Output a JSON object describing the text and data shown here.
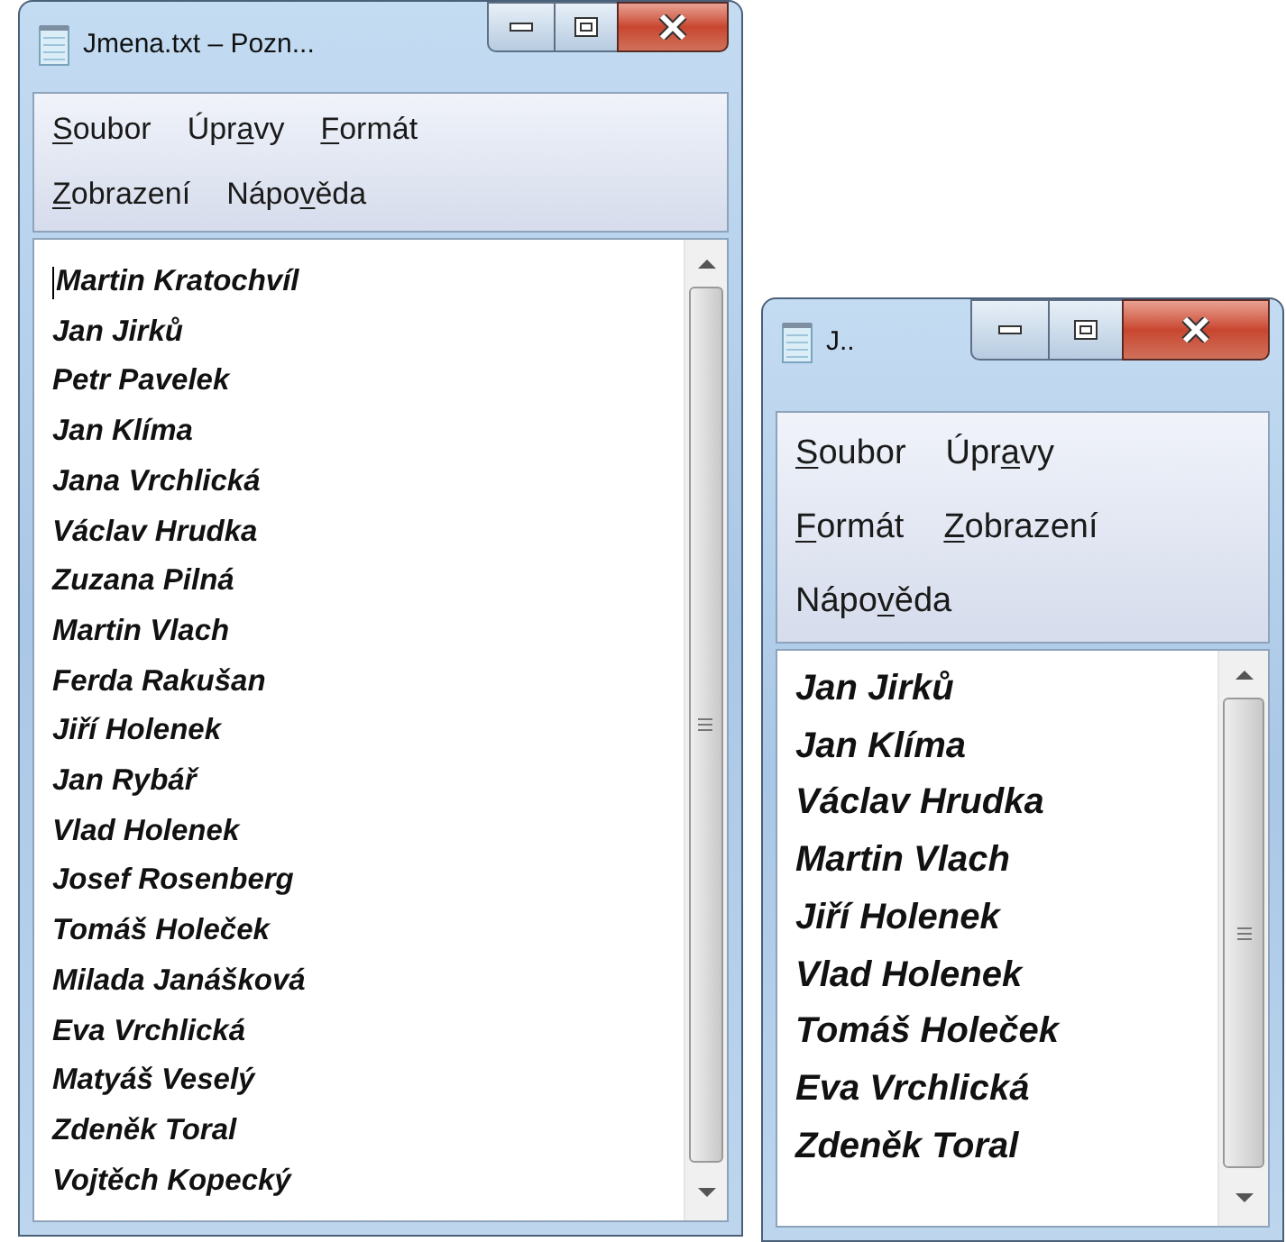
{
  "windows": [
    {
      "title": "Jmena.txt – Pozn...",
      "menu_rows": [
        [
          {
            "key": "S",
            "post": "oubor"
          },
          {
            "pre": "Úpr",
            "key": "a",
            "post": "vy"
          },
          {
            "key": "F",
            "post": "ormát"
          }
        ],
        [
          {
            "key": "Z",
            "post": "obrazení"
          },
          {
            "pre": "Nápo",
            "key": "v",
            "post": "ěda"
          }
        ]
      ],
      "caret": true,
      "lines": [
        "Martin Kratochvíl",
        "Jan Jirků",
        "Petr Pavelek",
        "Jan Klíma",
        "Jana Vrchlická",
        "Václav Hrudka",
        "Zuzana Pilná",
        "Martin Vlach",
        "Ferda Rakušan",
        "Jiří Holenek",
        "Jan Rybář",
        "Vlad Holenek",
        "Josef Rosenberg",
        "Tomáš Holeček",
        "Milada Janášková",
        "Eva Vrchlická",
        "Matyáš Veselý",
        "Zdeněk Toral",
        "Vojtěch Kopecký"
      ]
    },
    {
      "title": "J..",
      "menu_rows": [
        [
          {
            "key": "S",
            "post": "oubor"
          },
          {
            "pre": "Úpr",
            "key": "a",
            "post": "vy"
          }
        ],
        [
          {
            "key": "F",
            "post": "ormát"
          },
          {
            "key": "Z",
            "post": "obrazení"
          }
        ],
        [
          {
            "pre": "Nápo",
            "key": "v",
            "post": "ěda"
          }
        ]
      ],
      "caret": false,
      "lines": [
        "Jan Jirků",
        "Jan Klíma",
        "Václav Hrudka",
        "Martin Vlach",
        "Jiří Holenek",
        "Vlad Holenek",
        "Tomáš Holeček",
        "Eva Vrchlická",
        "Zdeněk Toral"
      ]
    }
  ]
}
